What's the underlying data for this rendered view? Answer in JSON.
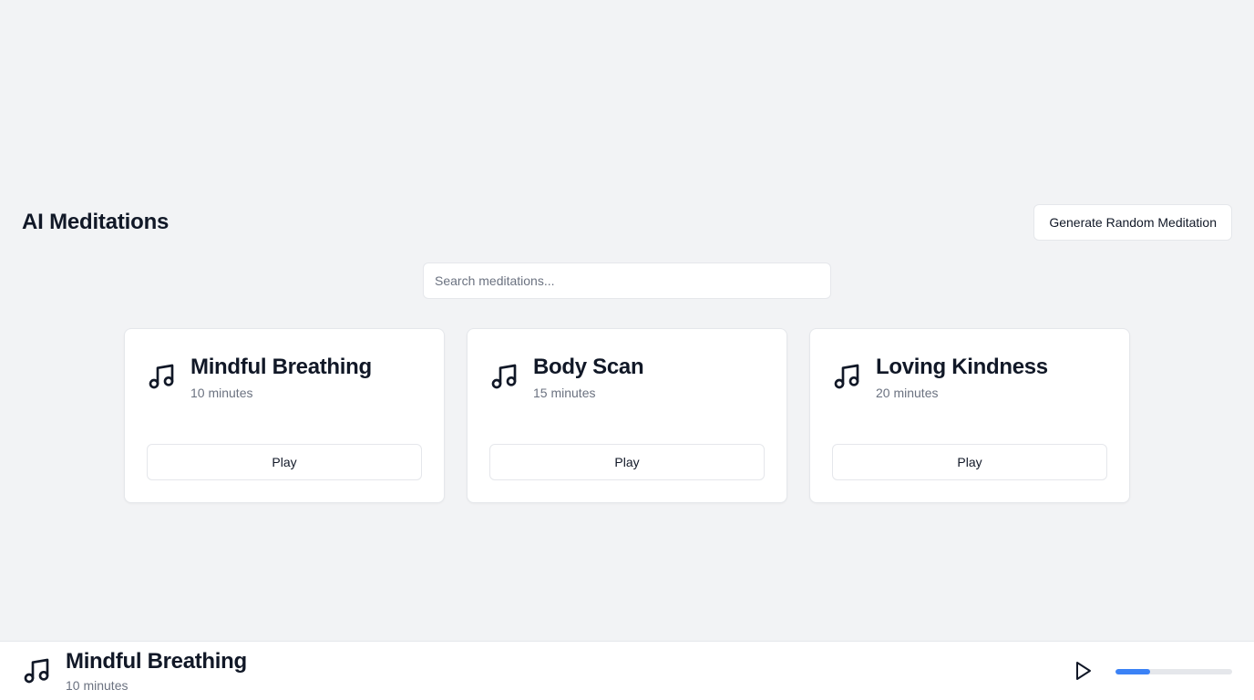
{
  "header": {
    "title": "AI Meditations",
    "generate_label": "Generate Random Meditation"
  },
  "search": {
    "placeholder": "Search meditations...",
    "value": ""
  },
  "meditations": [
    {
      "title": "Mindful Breathing",
      "duration": "10 minutes",
      "play_label": "Play",
      "icon": "music-icon"
    },
    {
      "title": "Body Scan",
      "duration": "15 minutes",
      "play_label": "Play",
      "icon": "music-icon"
    },
    {
      "title": "Loving Kindness",
      "duration": "20 minutes",
      "play_label": "Play",
      "icon": "music-icon"
    }
  ],
  "player": {
    "title": "Mindful Breathing",
    "duration": "10 minutes",
    "icon": "music-icon",
    "play_icon": "play-icon",
    "progress_percent": 30
  },
  "colors": {
    "background": "#f2f3f5",
    "accent": "#3b82f6"
  }
}
